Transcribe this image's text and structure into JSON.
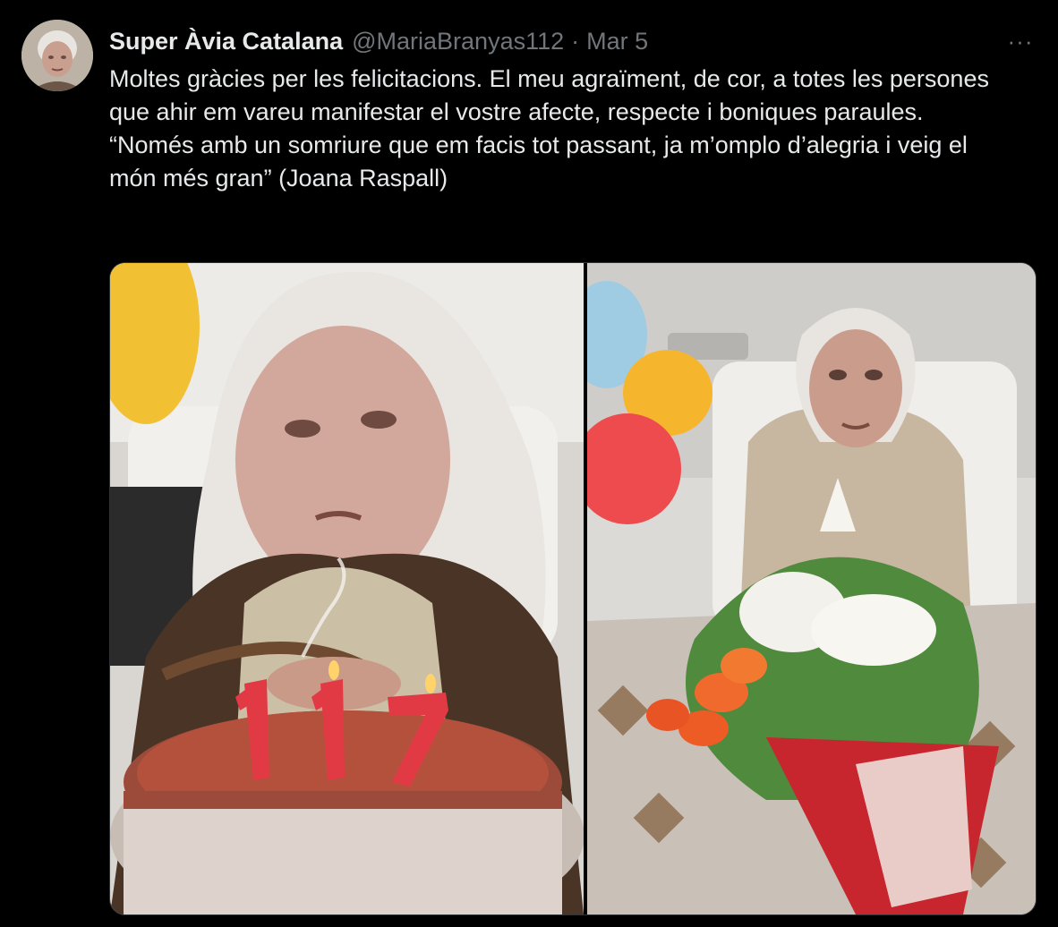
{
  "tweet": {
    "author": {
      "display_name": "Super Àvia Catalana",
      "handle": "@MariaBranyas112",
      "separator": "·",
      "date": "Mar 5",
      "avatar_icon": "avatar-photo"
    },
    "more_icon": "more-horizontal-icon",
    "more_label": "···",
    "text": {
      "paragraph_1": "Moltes gràcies per les felicitacions. El meu agraïment, de cor, a totes les persones que ahir em vareu manifestar el vostre afecte, respecte i boniques paraules.",
      "paragraph_2": "“Només amb un somriure que em facis tot passant, ja m’omplo d’alegria i veig el món més gran” (Joana Raspall)"
    },
    "media": {
      "photo_1": {
        "candle_text": "117"
      },
      "photo_2": {}
    }
  },
  "colors": {
    "background": "#000000",
    "primary_text": "#e7e9ea",
    "secondary_text": "#71767b",
    "border": "#2f3336"
  }
}
